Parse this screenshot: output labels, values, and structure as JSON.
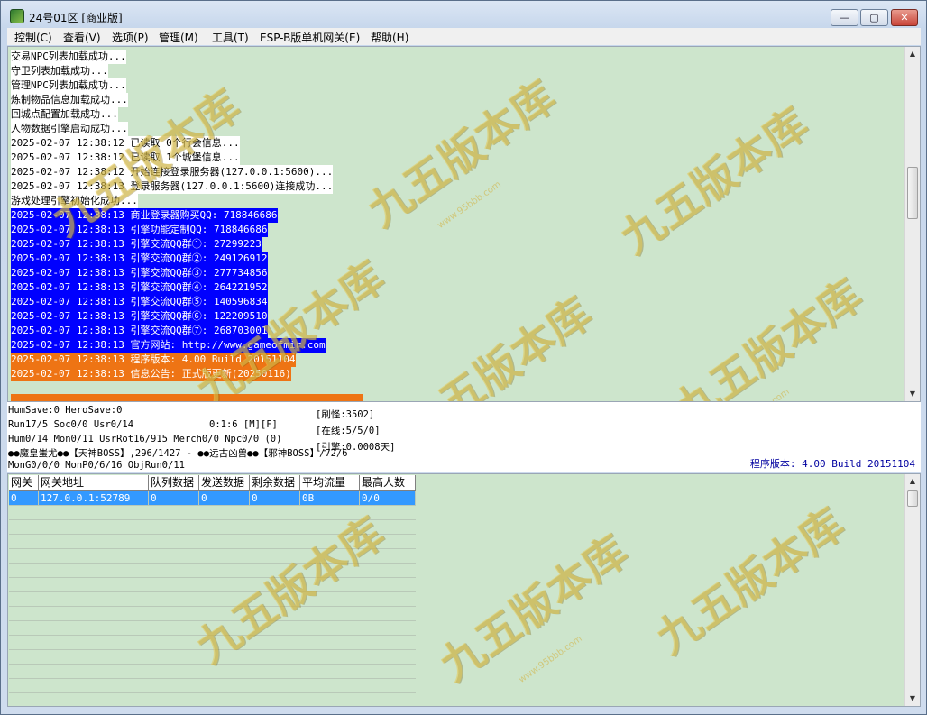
{
  "window": {
    "title": "24号01区 [商业版]",
    "buttons": {
      "minimize": "—",
      "maximize": "▢",
      "close": "✕"
    }
  },
  "menu": [
    "控制(C)",
    "查看(V)",
    "选项(P)",
    "管理(M)",
    "工具(T)",
    "ESP-B版单机网关(E)",
    "帮助(H)"
  ],
  "log": [
    {
      "text": "交易NPC列表加载成功...",
      "style": "plain"
    },
    {
      "text": "守卫列表加载成功...",
      "style": "plain"
    },
    {
      "text": "管理NPC列表加载成功...",
      "style": "plain"
    },
    {
      "text": "炼制物品信息加载成功...",
      "style": "plain"
    },
    {
      "text": "回城点配置加载成功...",
      "style": "plain"
    },
    {
      "text": "人物数据引擎启动成功...",
      "style": "plain"
    },
    {
      "text": "2025-02-07 12:38:12 已读取 0个行会信息...",
      "style": "plain"
    },
    {
      "text": "2025-02-07 12:38:12 已读取 1个城堡信息...",
      "style": "plain"
    },
    {
      "text": "2025-02-07 12:38:12 开始连接登录服务器(127.0.0.1:5600)...",
      "style": "plain"
    },
    {
      "text": "2025-02-07 12:38:13 登录服务器(127.0.0.1:5600)连接成功...",
      "style": "plain"
    },
    {
      "text": "游戏处理引擎初始化成功...",
      "style": "plain"
    },
    {
      "text": "2025-02-07 12:38:13 商业登录器购买QQ: 718846686",
      "style": "blue"
    },
    {
      "text": "2025-02-07 12:38:13 引擎功能定制QQ: 718846686",
      "style": "blue"
    },
    {
      "text": "2025-02-07 12:38:13 引擎交流QQ群①: 27299223",
      "style": "blue"
    },
    {
      "text": "2025-02-07 12:38:13 引擎交流QQ群②: 249126912",
      "style": "blue"
    },
    {
      "text": "2025-02-07 12:38:13 引擎交流QQ群③: 277734856",
      "style": "blue"
    },
    {
      "text": "2025-02-07 12:38:13 引擎交流QQ群④: 264221952",
      "style": "blue"
    },
    {
      "text": "2025-02-07 12:38:13 引擎交流QQ群⑤: 140596834",
      "style": "blue"
    },
    {
      "text": "2025-02-07 12:38:13 引擎交流QQ群⑥: 122209510",
      "style": "blue"
    },
    {
      "text": "2025-02-07 12:38:13 引擎交流QQ群⑦: 268703001",
      "style": "blue"
    },
    {
      "text": "2025-02-07 12:38:13 官方网站: http://www.gameofmir.com",
      "style": "blue"
    },
    {
      "text": "2025-02-07 12:38:13 程序版本: 4.00 Build 20151104",
      "style": "orange"
    },
    {
      "text": "2025-02-07 12:38:13 信息公告: 正式版更新(20250116)",
      "style": "orange"
    }
  ],
  "status": {
    "line1": "HumSave:0 HeroSave:0",
    "refresh": "[刷怪:3502]",
    "line2": "Run17/5 Soc0/0 Usr0/14",
    "line2b": "0:1:6 [M][F]",
    "online": "[在线:5/5/0]",
    "line3": "Hum0/14 Mon0/11 UsrRot16/915 Merch0/0 Npc0/0 (0)",
    "line4": "●●魔皇蚩尤●●【天神BOSS】,296/1427 - ●●远古凶兽●●【邪神BOSS】/72/6",
    "engine": "[引擎:0.0008天]",
    "line5": "MonG0/0/0 MonP0/6/16 ObjRun0/11",
    "version": "程序版本: 4.00 Build 20151104"
  },
  "grid": {
    "columns": [
      "网关",
      "网关地址",
      "队列数据",
      "发送数据",
      "剩余数据",
      "平均流量",
      "最高人数"
    ],
    "rows": [
      [
        "0",
        "127.0.0.1:52789",
        "0",
        "0",
        "0",
        "0B",
        "0/0"
      ]
    ]
  },
  "watermark": {
    "text": "九五版本库",
    "url": "www.95bbb.com"
  }
}
